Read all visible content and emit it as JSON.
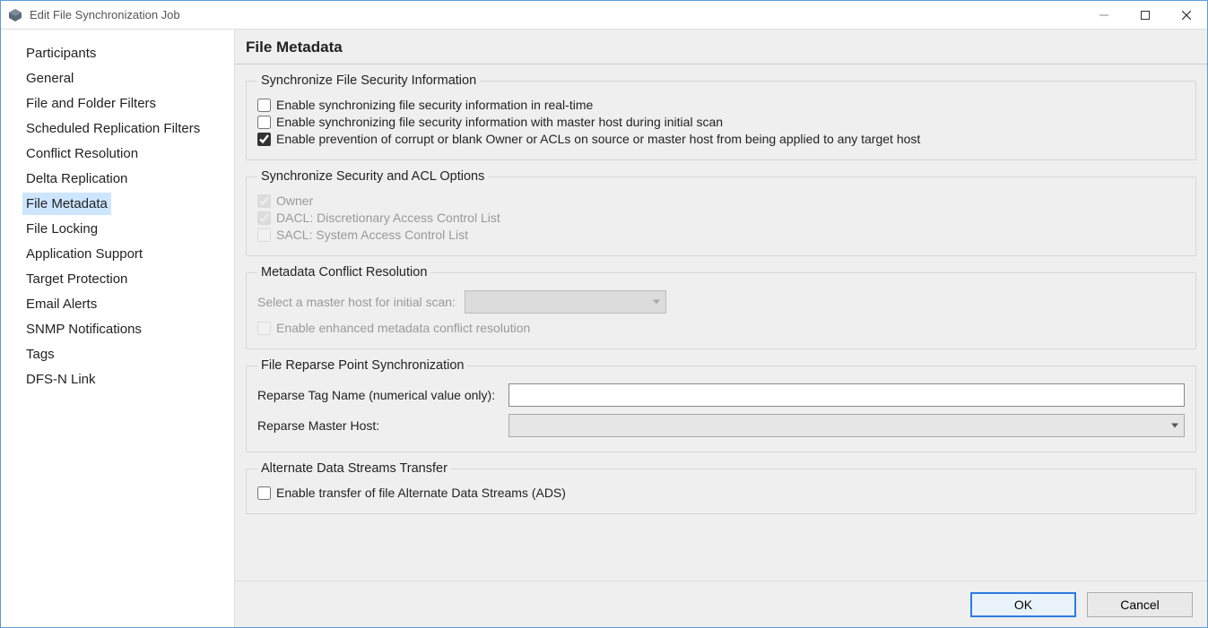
{
  "window": {
    "title": "Edit File Synchronization Job"
  },
  "sidebar": {
    "items": [
      {
        "label": "Participants"
      },
      {
        "label": "General"
      },
      {
        "label": "File and Folder Filters"
      },
      {
        "label": "Scheduled Replication Filters"
      },
      {
        "label": "Conflict Resolution"
      },
      {
        "label": "Delta Replication"
      },
      {
        "label": "File Metadata",
        "selected": true
      },
      {
        "label": "File Locking"
      },
      {
        "label": "Application Support"
      },
      {
        "label": "Target Protection"
      },
      {
        "label": "Email Alerts"
      },
      {
        "label": "SNMP Notifications"
      },
      {
        "label": "Tags"
      },
      {
        "label": "DFS-N Link"
      }
    ]
  },
  "heading": "File Metadata",
  "groups": {
    "sync_security": {
      "legend": "Synchronize File Security Information",
      "opt_rt": "Enable synchronizing file security information in real-time",
      "opt_init": "Enable synchronizing file security information with master host during initial scan",
      "opt_prev": "Enable prevention of corrupt or blank Owner or ACLs on source or master host from being applied to any target host"
    },
    "acl": {
      "legend": "Synchronize Security and ACL Options",
      "owner": "Owner",
      "dacl": "DACL: Discretionary Access Control List",
      "sacl": "SACL: System Access Control List"
    },
    "mcr": {
      "legend": "Metadata Conflict Resolution",
      "master_label": "Select a master host for initial scan:",
      "master_value": "",
      "enhanced": "Enable enhanced metadata conflict resolution"
    },
    "reparse": {
      "legend": "File Reparse Point Synchronization",
      "tag_label": "Reparse Tag Name (numerical value only):",
      "tag_value": "",
      "host_label": "Reparse Master Host:",
      "host_value": ""
    },
    "ads": {
      "legend": "Alternate Data Streams Transfer",
      "enable": "Enable transfer of file Alternate Data Streams (ADS)"
    }
  },
  "buttons": {
    "ok": "OK",
    "cancel": "Cancel"
  }
}
